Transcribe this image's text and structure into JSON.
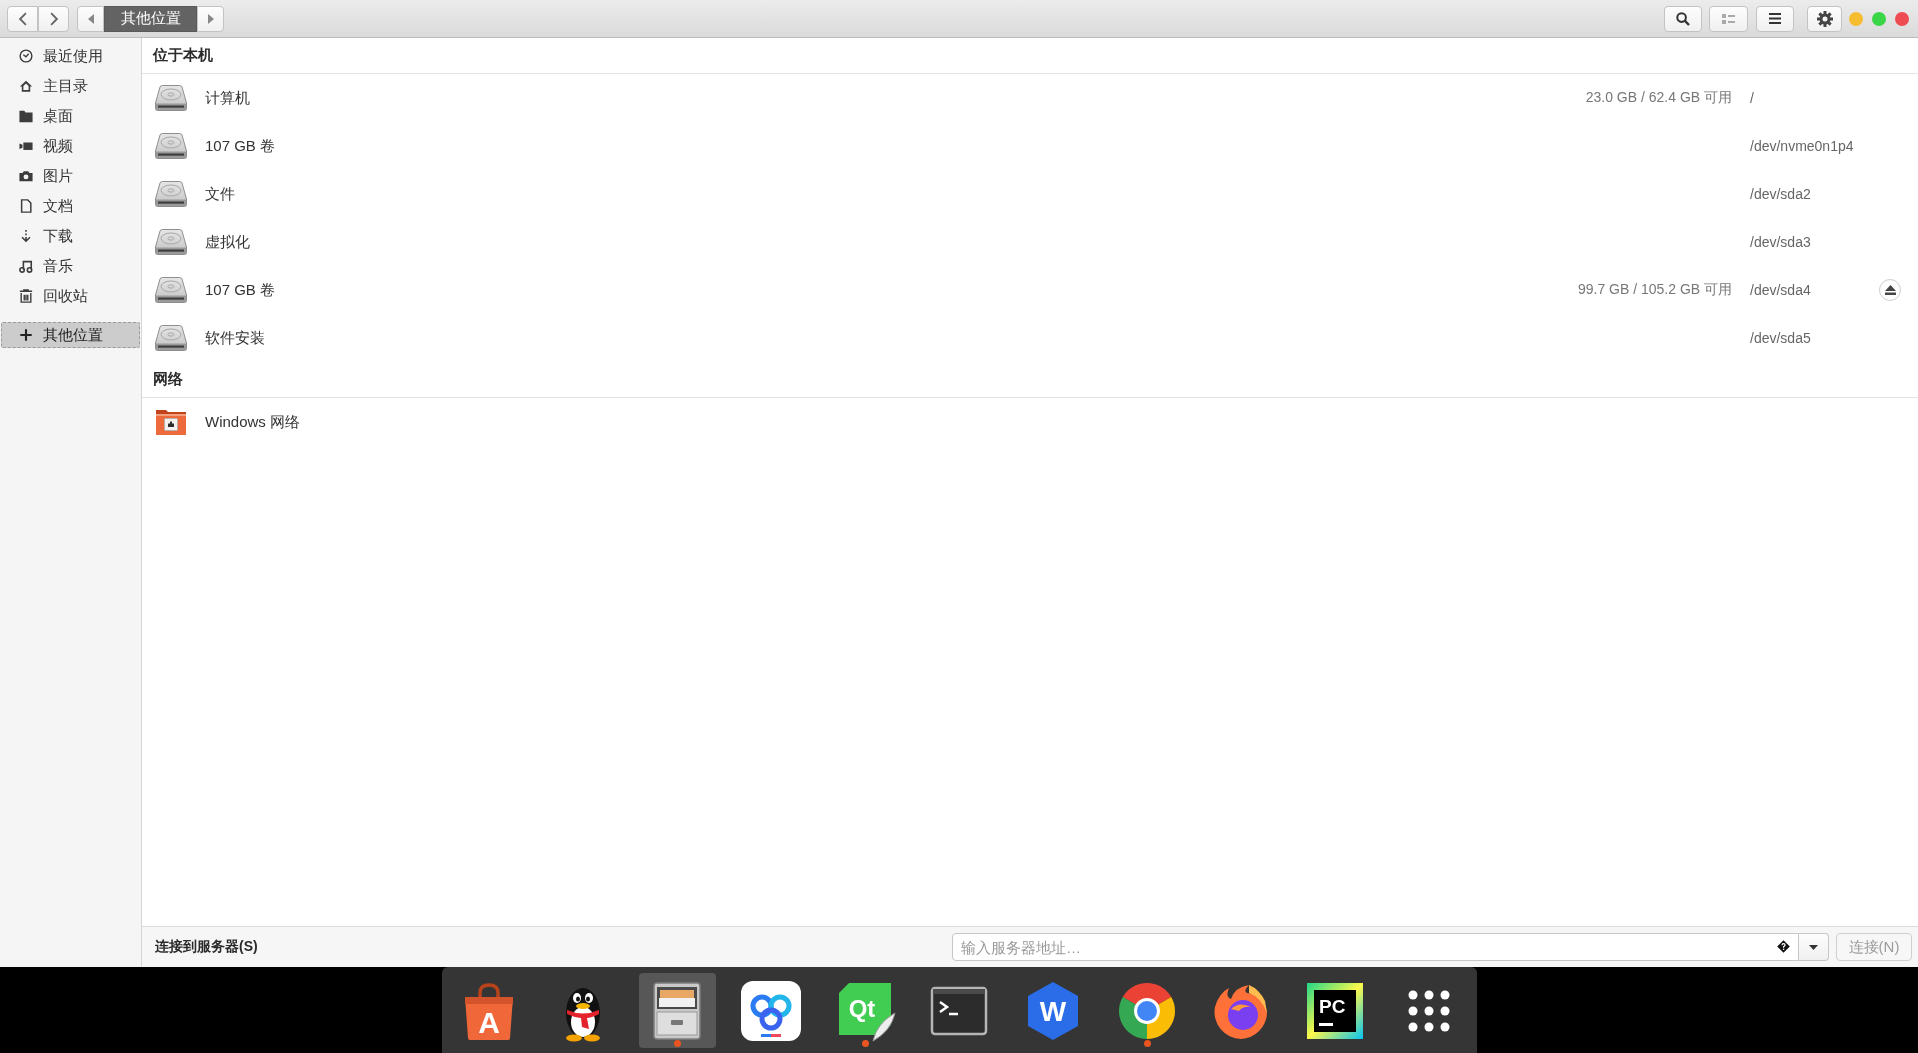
{
  "path_bar": [
    {
      "label": "其他位置",
      "selected": true
    }
  ],
  "sidebar": {
    "items": [
      {
        "kind": "recent",
        "label": "最近使用",
        "selected": false
      },
      {
        "kind": "home",
        "label": "主目录",
        "selected": false
      },
      {
        "kind": "desktop",
        "label": "桌面",
        "selected": false
      },
      {
        "kind": "videos",
        "label": "视频",
        "selected": false
      },
      {
        "kind": "pictures",
        "label": "图片",
        "selected": false
      },
      {
        "kind": "documents",
        "label": "文档",
        "selected": false
      },
      {
        "kind": "downloads",
        "label": "下载",
        "selected": false
      },
      {
        "kind": "music",
        "label": "音乐",
        "selected": false
      },
      {
        "kind": "trash",
        "label": "回收站",
        "selected": false
      },
      {
        "kind": "other",
        "label": "其他位置",
        "selected": true
      }
    ]
  },
  "sections": [
    {
      "title": "位于本机",
      "items": [
        {
          "kind": "drive",
          "name": "计算机",
          "usage": "23.0 GB / 62.4 GB 可用",
          "mount": "/",
          "eject": false
        },
        {
          "kind": "drive",
          "name": "107 GB 卷",
          "mount": "/dev/nvme0n1p4",
          "eject": false
        },
        {
          "kind": "drive",
          "name": "文件",
          "mount": "/dev/sda2",
          "eject": false
        },
        {
          "kind": "drive",
          "name": "虚拟化",
          "mount": "/dev/sda3",
          "eject": false
        },
        {
          "kind": "drive",
          "name": "107 GB 卷",
          "usage": "99.7 GB / 105.2 GB 可用",
          "mount": "/dev/sda4",
          "eject": true
        },
        {
          "kind": "drive",
          "name": "软件安装",
          "mount": "/dev/sda5",
          "eject": false
        }
      ]
    },
    {
      "title": "网络",
      "items": [
        {
          "kind": "network",
          "name": "Windows 网络",
          "eject": false
        }
      ]
    }
  ],
  "connect_bar": {
    "label": "连接到服务器(S)",
    "address": {
      "placeholder": "输入服务器地址…"
    },
    "connect_button": {
      "label": "连接(N)",
      "disabled": true
    }
  },
  "dock": {
    "items": [
      {
        "kind": "bag",
        "logo_text": "A",
        "running": false,
        "selected": false
      },
      {
        "kind": "penguin",
        "running": false,
        "selected": false
      },
      {
        "kind": "cabinet",
        "running": true,
        "selected": true
      },
      {
        "kind": "rings",
        "running": false,
        "selected": false
      },
      {
        "kind": "tile",
        "logo_text": "Qt",
        "running": true,
        "selected": false
      },
      {
        "kind": "terminal",
        "running": false,
        "selected": false
      },
      {
        "kind": "hexagon",
        "logo_text": "W",
        "running": false,
        "selected": false
      },
      {
        "kind": "pinwheel",
        "running": true,
        "selected": false
      },
      {
        "kind": "flame",
        "running": false,
        "selected": false
      },
      {
        "kind": "square",
        "logo_text": "PC",
        "running": false,
        "selected": false
      },
      {
        "kind": "grid",
        "running": false,
        "selected": false
      }
    ]
  }
}
